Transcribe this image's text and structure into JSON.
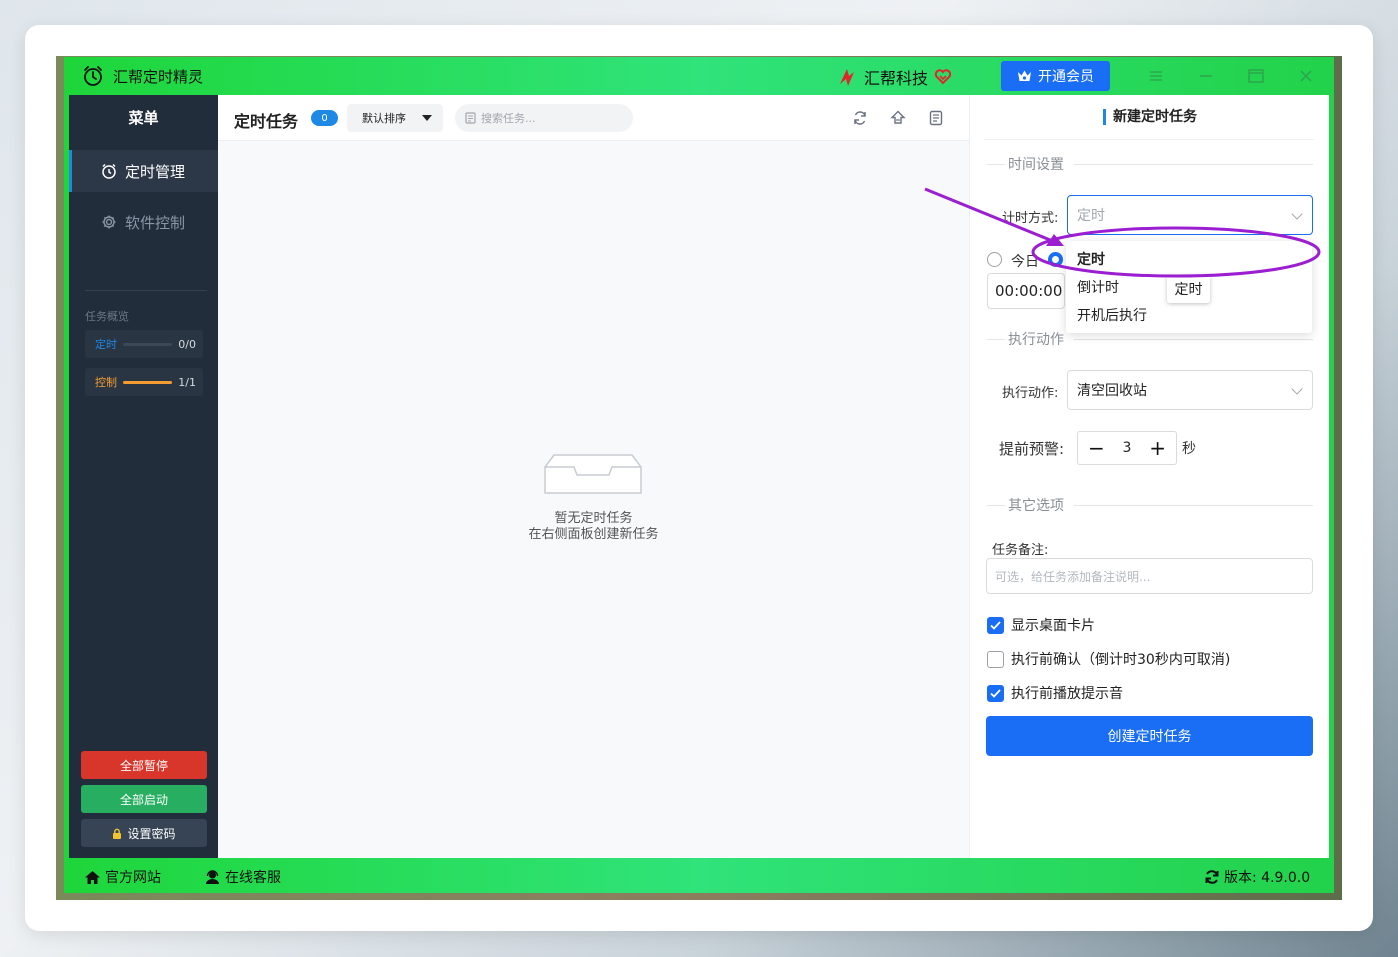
{
  "window": {
    "title": "汇帮定时精灵"
  },
  "header": {
    "brand": "汇帮科技",
    "vip_button": "开通会员"
  },
  "sidebar": {
    "menu_title": "菜单",
    "items": [
      {
        "label": "定时管理",
        "icon": "alarm-clock-icon",
        "active": true
      },
      {
        "label": "软件控制",
        "icon": "gear-icon",
        "active": false
      }
    ],
    "overview_label": "任务概览",
    "stats": [
      {
        "label": "定时",
        "value": "0/0",
        "progress": 0,
        "color": "#1e88e5"
      },
      {
        "label": "控制",
        "value": "1/1",
        "progress": 1,
        "color": "#f39c32"
      }
    ],
    "buttons": {
      "pause_all": "全部暂停",
      "start_all": "全部启动",
      "set_password": "设置密码"
    },
    "colors": {
      "pause": "#d9362b",
      "start": "#27ae60",
      "password": "#364455"
    }
  },
  "main": {
    "title": "定时任务",
    "count": "0",
    "sort_label": "默认排序",
    "search_placeholder": "搜索任务...",
    "empty_title": "暂无定时任务",
    "empty_hint": "在右侧面板创建新任务"
  },
  "panel": {
    "title": "新建定时任务",
    "section_time": "时间设置",
    "timing_mode_label": "计时方式:",
    "timing_mode_value": "定时",
    "today_label": "今日",
    "time_value": "00:00:00",
    "section_action": "执行动作",
    "action_label": "执行动作:",
    "action_value": "清空回收站",
    "warn_label": "提前预警:",
    "warn_value": "3",
    "warn_unit": "秒",
    "section_other": "其它选项",
    "note_label": "任务备注:",
    "note_placeholder": "可选，给任务添加备注说明...",
    "checks": [
      {
        "label": "显示桌面卡片",
        "checked": true
      },
      {
        "label": "执行前确认（倒计时30秒内可取消)",
        "checked": false
      },
      {
        "label": "执行前播放提示音",
        "checked": true
      }
    ],
    "create_button": "创建定时任务"
  },
  "dropdown": {
    "options": [
      "定时",
      "倒计时",
      "开机后执行"
    ],
    "selected": "定时",
    "tooltip": "定时"
  },
  "footer": {
    "website": "官方网站",
    "support": "在线客服",
    "version": "版本: 4.9.0.0"
  },
  "colors": {
    "accent": "#1a6ef5",
    "titlebar_green": "#22d24a",
    "sidebar_bg": "#222d3b",
    "annotation": "#9b1ed1"
  }
}
